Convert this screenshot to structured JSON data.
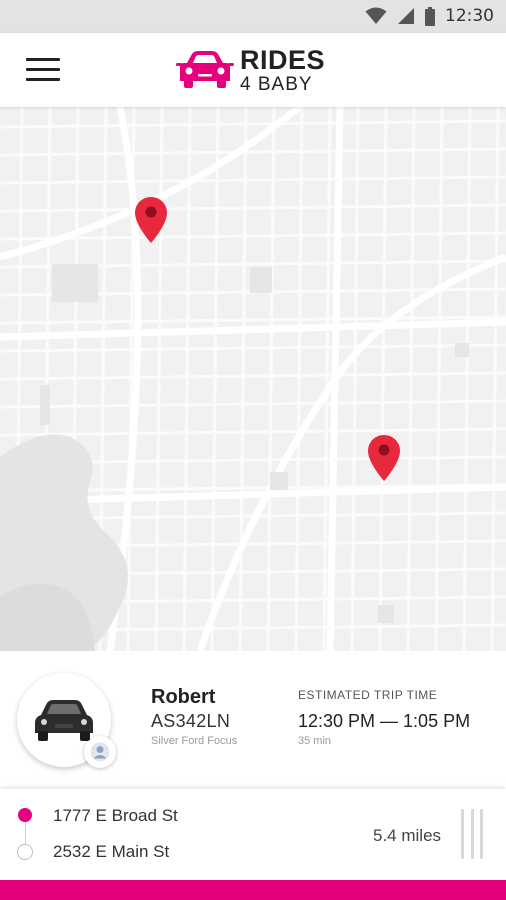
{
  "status_bar": {
    "time": "12:30"
  },
  "header": {
    "logo_title": "RIDES",
    "logo_subtitle": "4 BABY",
    "menu_icon": "hamburger-menu-icon",
    "logo_icon": "car-icon",
    "brand_color": "#e6007e"
  },
  "map": {
    "pins": [
      {
        "name": "pickup",
        "icon": "map-pin-icon",
        "color": "#e8283c"
      },
      {
        "name": "dropoff",
        "icon": "map-pin-icon",
        "color": "#e8283c"
      }
    ]
  },
  "driver": {
    "name": "Robert",
    "plate": "AS342LN",
    "car": "Silver Ford Focus",
    "avatar_icon": "car-icon",
    "profile_icon": "user-icon"
  },
  "trip": {
    "label": "ESTIMATED TRIP TIME",
    "time_range": "12:30 PM — 1:05 PM",
    "duration": "35 min"
  },
  "route": {
    "origin": "1777 E Broad St",
    "destination": "2532 E Main St",
    "distance": "5.4 miles"
  }
}
